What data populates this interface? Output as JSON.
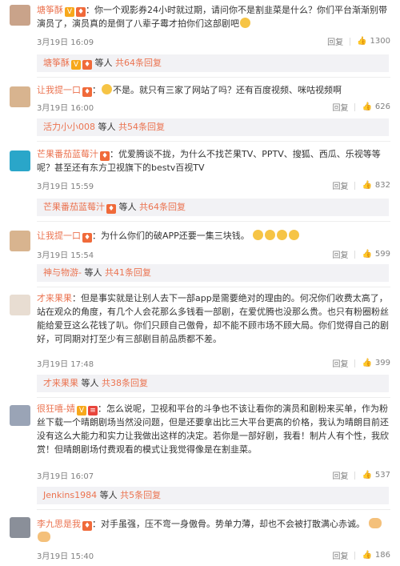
{
  "comments": [
    {
      "user": "塘筝酥",
      "badges": [
        "V",
        "v"
      ],
      "text": "：你一个观影券24小时就过期，请问你不是割韭菜是什么？你们平台渐渐别带演员了，演员真的是倒了八辈子霉才拍你们这部剧吧",
      "time": "3月19日 16:09",
      "reply": "回复",
      "likes": "1300",
      "reply_user": "塘筝酥",
      "reply_etc": "等人",
      "reply_count": "共64条回复"
    },
    {
      "user": "让我提一口",
      "badges": [
        "v"
      ],
      "text": "不是。就只有三家了网站了吗？还有百度视频、咪咕视频啊",
      "time": "3月19日 16:00",
      "reply": "回复",
      "likes": "626",
      "reply_user": "活力小小008",
      "reply_etc": "等人",
      "reply_count": "共54条回复"
    },
    {
      "user": "芒果番茄蓝莓汁",
      "badges": [
        "v"
      ],
      "text": "：优爱腾谈不拢，为什么不找芒果TV、PPTV、搜狐、西瓜、乐视等等呢？甚至还有东方卫视旗下的bestv百视TV",
      "time": "3月19日 15:59",
      "reply": "回复",
      "likes": "832",
      "reply_user": "芒果番茄蓝莓汁",
      "reply_etc": "等人",
      "reply_count": "共64条回复"
    },
    {
      "user": "让我提一口",
      "badges": [
        "v"
      ],
      "text": "：为什么你们的破APP还要一集三块钱。",
      "time": "3月19日 15:54",
      "reply": "回复",
      "likes": "599",
      "reply_user": "神与物游-",
      "reply_etc": "等人",
      "reply_count": "共41条回复"
    },
    {
      "user": "才来果果",
      "badges": [],
      "text": "：但是事实就是让别人去下一部app是需要绝对的理由的。何况你们收费太高了，站在观众的角度，有几个人会花那么多钱看一部剧，在爱优腾也没那么贵。也只有粉圈粉丝能给爱豆这么花钱了叭。你们只顾自己傲骨，却不能不顾市场不顾大局。你们觉得自己的剧好，可同期对打至少有三部剧目前品质都不差。",
      "time": "3月19日 17:48",
      "reply": "回复",
      "likes": "399",
      "reply_user": "才来果果",
      "reply_etc": "等人",
      "reply_count": "共38条回复"
    },
    {
      "user": "很狂嘻-婧",
      "badges": [
        "V"
      ],
      "text": "：怎么说呢，卫视和平台的斗争也不该让看你的演员和剧粉来买单，作为粉丝下载一个晴朗剧场当然没问题，但是还要拿出比三大平台更高的价格，我认为晴朗目前还没有这么大能力和实力让我做出这样的决定。若你是一部好剧，我看！制片人有个性，我欣赏！但晴朗剧场付费观看的模式让我觉得像是在割韭菜。",
      "time": "3月19日 16:07",
      "reply": "回复",
      "likes": "537",
      "reply_user": "Jenkins1984",
      "reply_etc": "等人",
      "reply_count": "共5条回复"
    },
    {
      "user": "李九思是我",
      "badges": [
        "v"
      ],
      "text": "：对手虽强，压不弯一身傲骨。势单力薄，却也不会被打散满心赤诚。",
      "time": "3月19日 15:40",
      "reply": "回复",
      "likes": "186"
    }
  ],
  "colors": {
    "name": "#eb7350",
    "meta": "#808080",
    "reply_bg": "#f2f2f5"
  }
}
